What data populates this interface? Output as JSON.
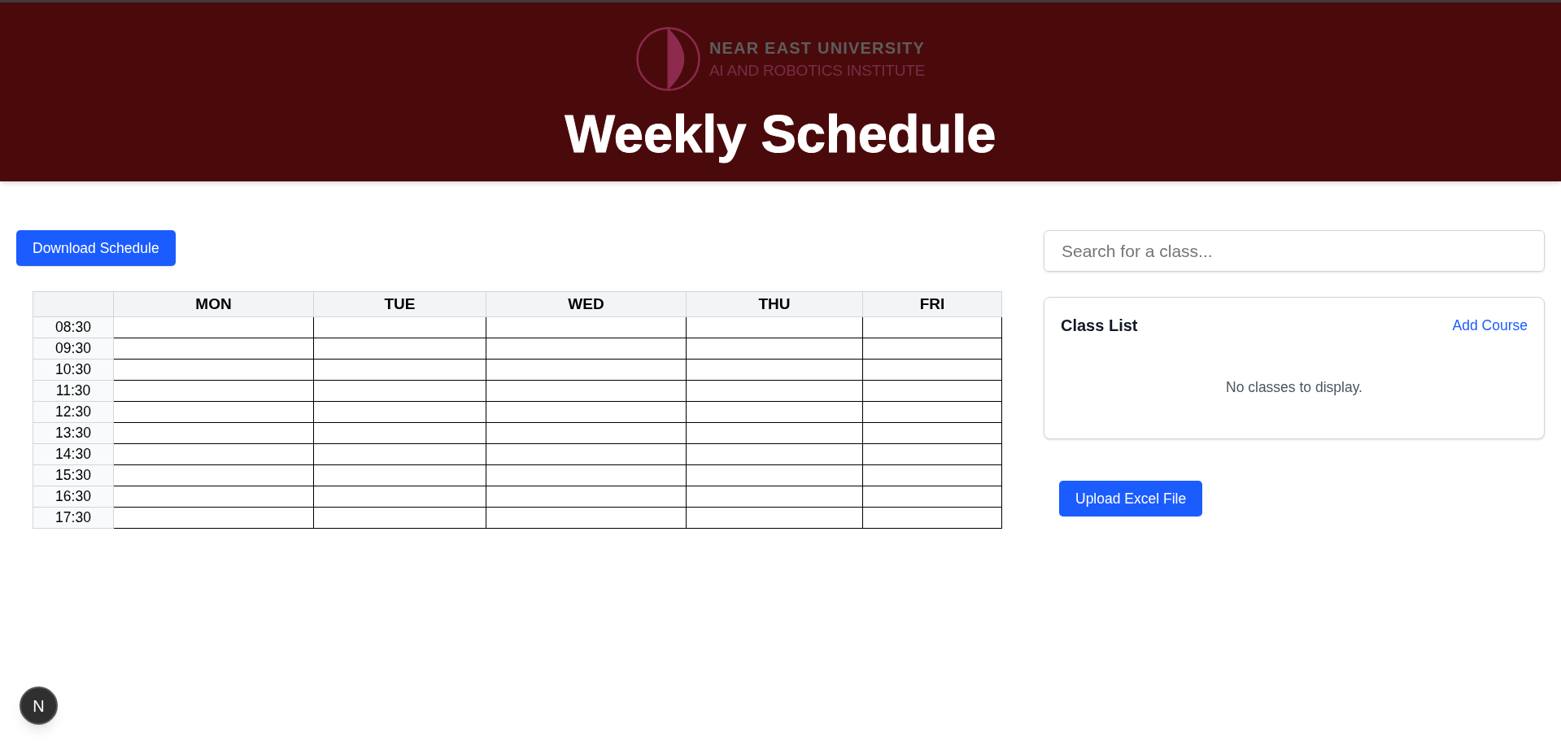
{
  "header": {
    "logo": {
      "line_1": "NEAR EAST UNIVERSITY",
      "line_2": "AI AND ROBOTICS INSTITUTE"
    },
    "title": "Weekly Schedule"
  },
  "download_button": "Download Schedule",
  "schedule": {
    "columns": [
      "MON",
      "TUE",
      "WED",
      "THU",
      "FRI"
    ],
    "rows": [
      "08:30",
      "09:30",
      "10:30",
      "11:30",
      "12:30",
      "13:30",
      "14:30",
      "15:30",
      "16:30",
      "17:30"
    ]
  },
  "search": {
    "placeholder": "Search for a class..."
  },
  "class_list": {
    "title": "Class List",
    "action": "Add Course",
    "empty_message": "No classes to display."
  },
  "upload_button": "Upload Excel File",
  "dev_indicator": "N"
}
